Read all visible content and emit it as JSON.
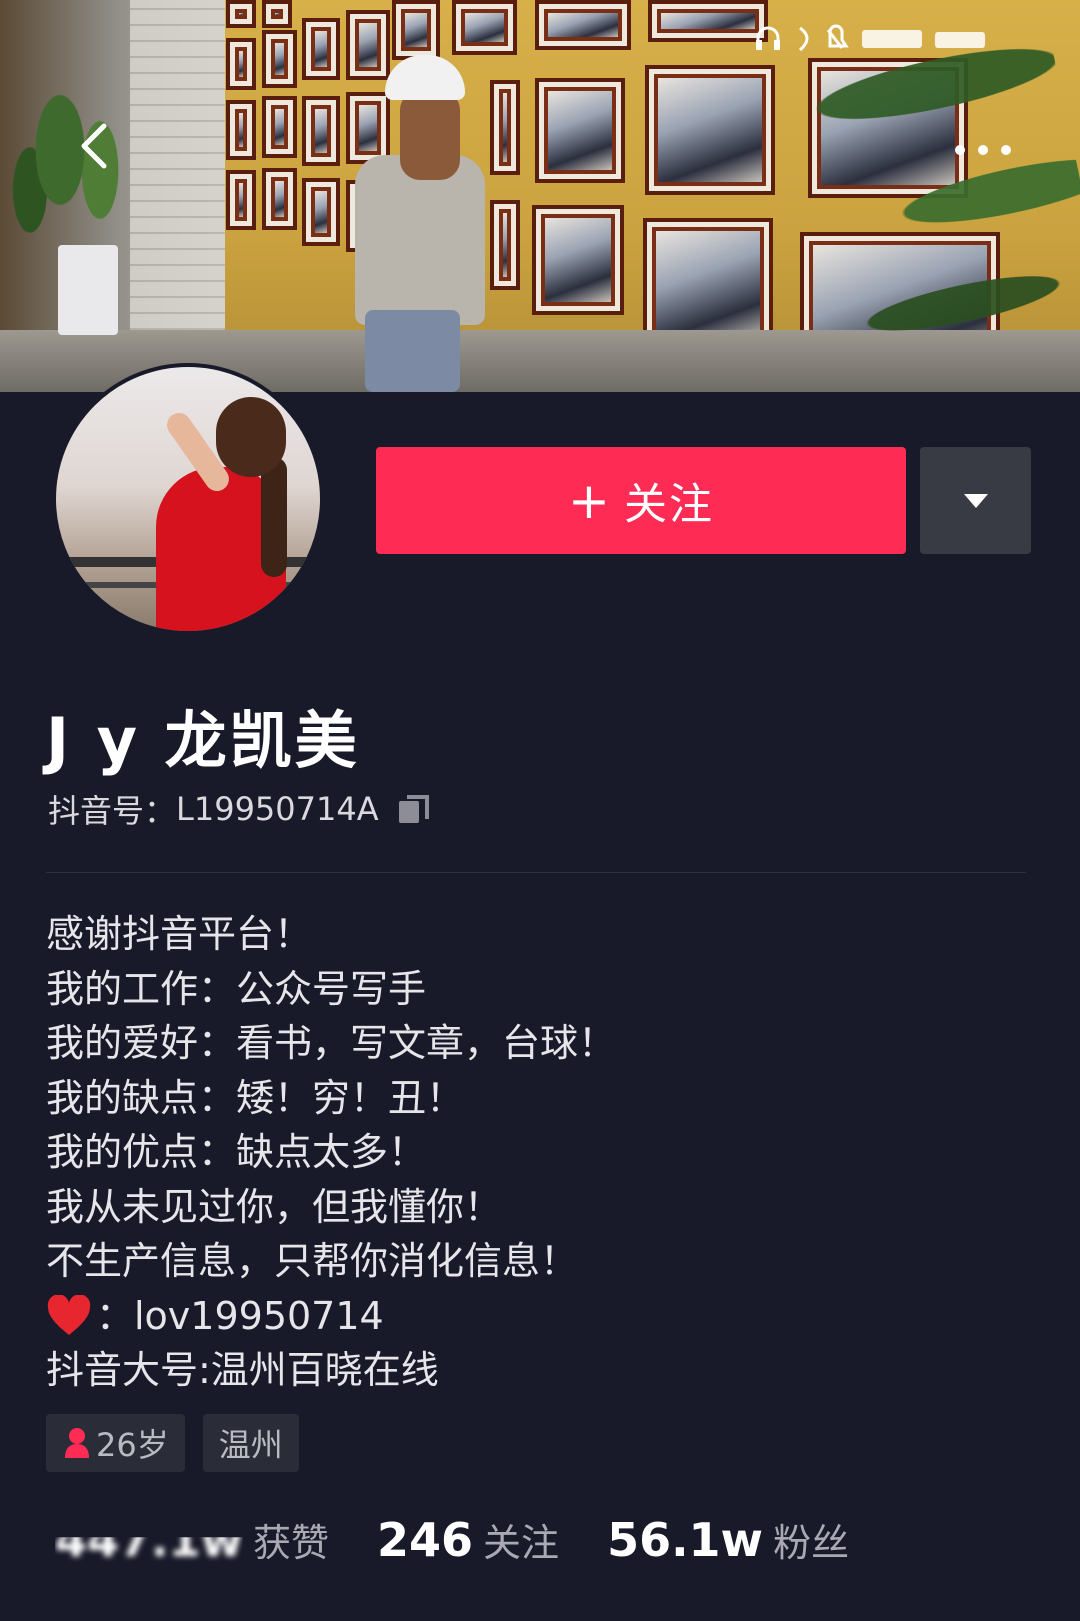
{
  "header": {
    "back_icon": "chevron-left-icon",
    "more_icon": "more-horizontal-icon"
  },
  "profile": {
    "follow_label": "关注",
    "follow_plus": "+",
    "dropdown_icon": "caret-down-icon",
    "name": "J y 龙凯美",
    "id_label": "抖音号：",
    "id_value": "L19950714A",
    "copy_icon": "copy-icon"
  },
  "bio": {
    "lines": [
      "感谢抖音平台！",
      "我的工作：公众号写手",
      "我的爱好：看书，写文章，台球！",
      "我的缺点：矮！穷！丑！",
      "我的优点：缺点太多！",
      "我从未见过你，但我懂你！",
      "不生产信息，只帮你消化信息！"
    ],
    "heart_text": "：lov19950714",
    "last_line": "抖音大号:温州百晓在线"
  },
  "tags": {
    "age": "26岁",
    "city": "温州"
  },
  "stats": {
    "likes_num": "447.1w",
    "likes_label": "获赞",
    "following_num": "246",
    "following_label": "关注",
    "fans_num": "56.1w",
    "fans_label": "粉丝"
  },
  "colors": {
    "background": "#181a29",
    "follow_button": "#fe2c55",
    "dropdown_button": "#393b44",
    "tag_bg": "#2a2c38",
    "heart": "#e8262f",
    "female_icon": "#fe2c55"
  }
}
